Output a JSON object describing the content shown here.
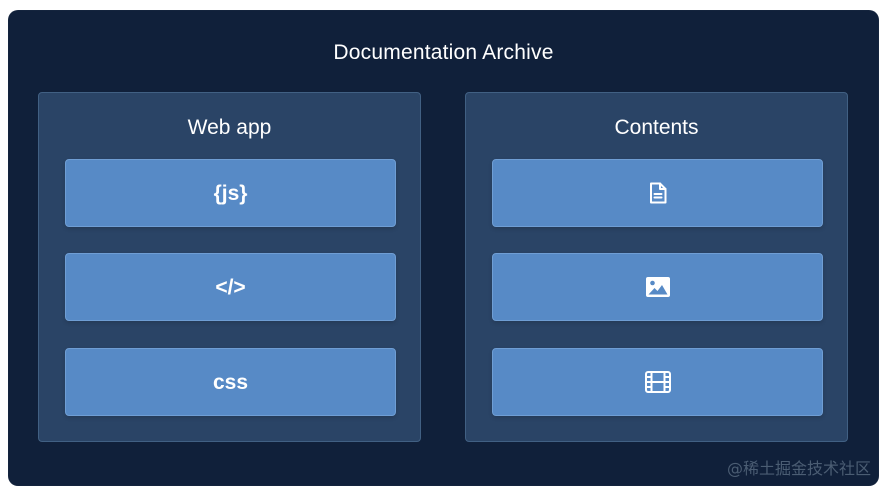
{
  "title": "Documentation Archive",
  "panels": {
    "web_app": {
      "title": "Web app",
      "items": [
        {
          "label": "{js}"
        },
        {
          "label": "</>"
        },
        {
          "label": "css"
        }
      ]
    },
    "contents": {
      "title": "Contents",
      "items": [
        {
          "icon": "document-icon"
        },
        {
          "icon": "image-icon"
        },
        {
          "icon": "film-icon"
        }
      ]
    }
  },
  "watermark": "@稀土掘金技术社区",
  "colors": {
    "background": "#10203a",
    "panel": "#2a4466",
    "card": "#578ac6",
    "text": "#ffffff"
  }
}
